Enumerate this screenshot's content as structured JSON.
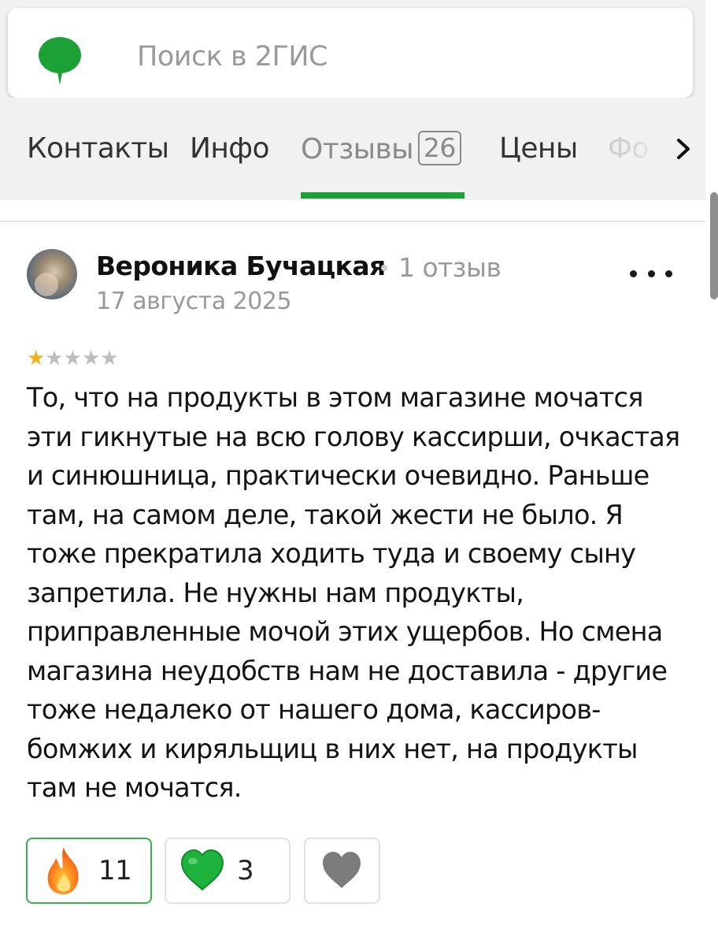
{
  "search": {
    "placeholder": "Поиск в 2ГИС",
    "logo": "2gis-leaf-logo",
    "accent": "#1ba136"
  },
  "tabs": [
    {
      "label": "Контакты"
    },
    {
      "label": "Инфо"
    },
    {
      "label": "Отзывы",
      "count": "26",
      "active": true
    },
    {
      "label": "Цены"
    },
    {
      "label": "Фо"
    }
  ],
  "review": {
    "author": "Вероника Бучацкая",
    "author_reviews": "1 отзыв",
    "date": "17 августа 2025",
    "rating": 1,
    "rating_max": 5,
    "text": "То, что на продукты в этом магазине мочатся эти гикнутые на всю голову кассирши, очкастая и синюшница, практически очевидно. Раньше там, на самом деле, такой жести не было. Я тоже прекратила ходить туда и своему сыну запретила. Не нужны нам продукты, приправленные мочой этих ущербов. Но смена магазина неудобств нам не доставила - другие тоже недалеко от нашего дома, кассиров-бомжих и киряльщиц в них нет, на продукты там не мочатся.",
    "reactions": [
      {
        "icon": "fire-icon",
        "count": "11",
        "active": true
      },
      {
        "icon": "green-heart-icon",
        "count": "3",
        "active": false
      },
      {
        "icon": "grey-heart-icon",
        "active": false
      }
    ]
  }
}
